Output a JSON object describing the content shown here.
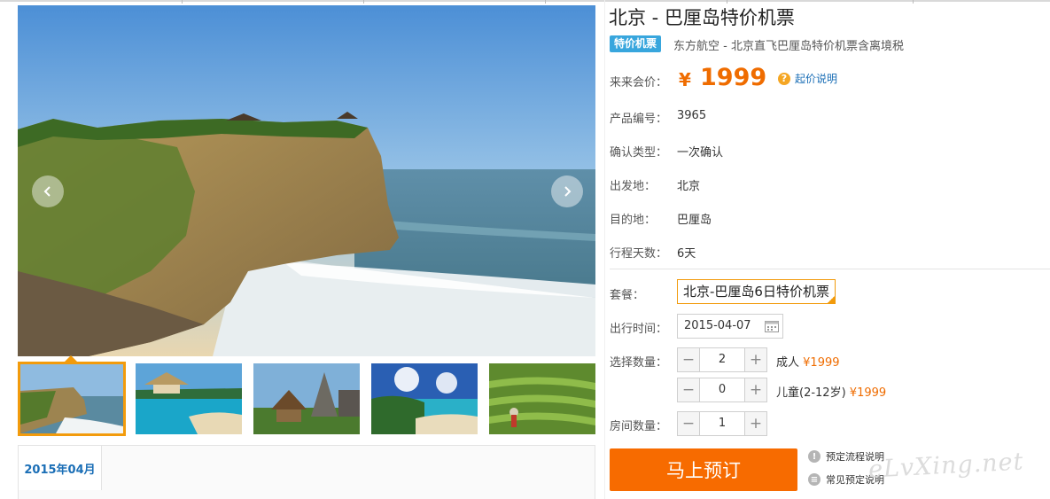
{
  "product": {
    "title": "北京 - 巴厘岛特价机票",
    "tag": "特价机票",
    "subtitle": "东方航空 - 北京直飞巴厘岛特价机票含离境税"
  },
  "price": {
    "label": "来来会价：",
    "currency": "¥",
    "amount": "1999",
    "help_link": "起价说明",
    "help_icon": "?"
  },
  "details": [
    {
      "label": "产品编号：",
      "value": "3965"
    },
    {
      "label": "确认类型：",
      "value": "一次确认"
    },
    {
      "label": "出发地：",
      "value": "北京"
    },
    {
      "label": "目的地：",
      "value": "巴厘岛"
    },
    {
      "label": "行程天数：",
      "value": "6天"
    }
  ],
  "booking": {
    "package_label": "套餐：",
    "package_value": "北京-巴厘岛6日特价机票",
    "date_label": "出行时间：",
    "date_value": "2015-04-07",
    "qty_label": "选择数量：",
    "adult_qty": "2",
    "adult_note": "成人",
    "adult_price": "¥1999",
    "child_qty": "0",
    "child_note": "儿童(2-12岁)",
    "child_price": "¥1999",
    "room_label": "房间数量：",
    "room_qty": "1",
    "minus": "−",
    "plus": "+"
  },
  "actions": {
    "book_now": "马上预订",
    "process_link": "预定流程说明",
    "faq_link": "常见预定说明",
    "info_icon": "!"
  },
  "calendar": {
    "month_tab": "2015年04月"
  },
  "gallery": {
    "thumb_count": 5,
    "active_thumb": 1
  },
  "watermark": "eLvXing.net",
  "colors": {
    "accent_orange": "#f76b00",
    "price_orange": "#ef6c00",
    "tag_blue": "#38a6dd",
    "link_blue": "#1a6eb6",
    "thumb_border": "#f29b0c"
  }
}
